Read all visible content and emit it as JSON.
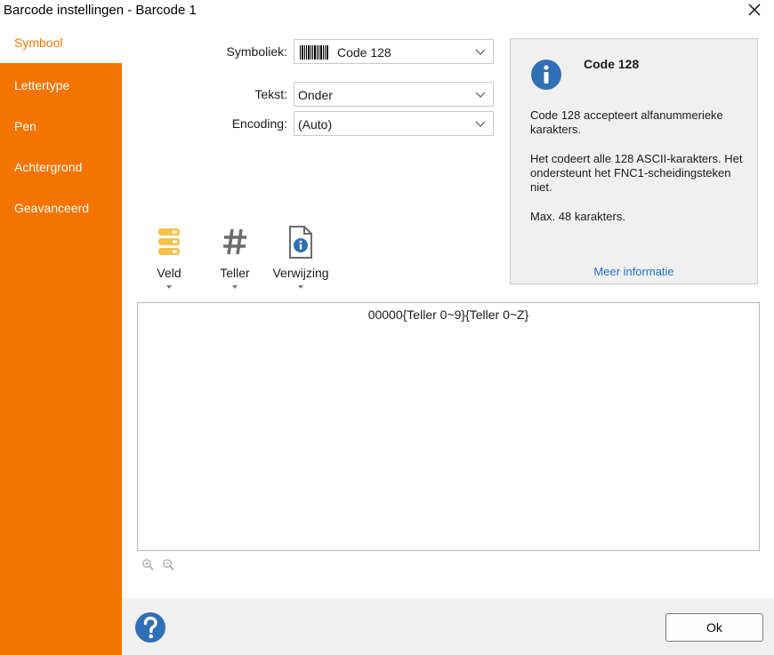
{
  "window": {
    "title": "Barcode instellingen - Barcode 1"
  },
  "sidebar": {
    "items": [
      {
        "label": "Symbool"
      },
      {
        "label": "Lettertype"
      },
      {
        "label": "Pen"
      },
      {
        "label": "Achtergrond"
      },
      {
        "label": "Geavanceerd"
      }
    ],
    "active_index": 0
  },
  "form": {
    "symbology_label": "Symboliek:",
    "symbology_value": "Code 128",
    "text_label": "Tekst:",
    "text_value": "Onder",
    "encoding_label": "Encoding:",
    "encoding_value": "(Auto)"
  },
  "info": {
    "title": "Code 128",
    "para1": "Code 128 accepteert alfanummerieke karakters.",
    "para2": "Het codeert alle 128 ASCII-karakters. Het ondersteunt het FNC1-scheidingsteken niet.",
    "para3": "Max. 48 karakters.",
    "link": "Meer informatie"
  },
  "toolbar": {
    "field_label": "Veld",
    "counter_label": "Teller",
    "reference_label": "Verwijzing"
  },
  "editor": {
    "content": "00000{Teller 0~9}{Teller 0~Z}"
  },
  "footer": {
    "ok_label": "Ok"
  },
  "colors": {
    "accent": "#f57400",
    "link": "#1f6fc5",
    "info_icon": "#2f6fb5"
  },
  "icons": [
    "close-icon",
    "barcode-icon",
    "chevron-down-icon",
    "info-icon",
    "database-icon",
    "hash-icon",
    "document-info-icon",
    "zoom-in-icon",
    "zoom-out-icon",
    "help-icon"
  ]
}
